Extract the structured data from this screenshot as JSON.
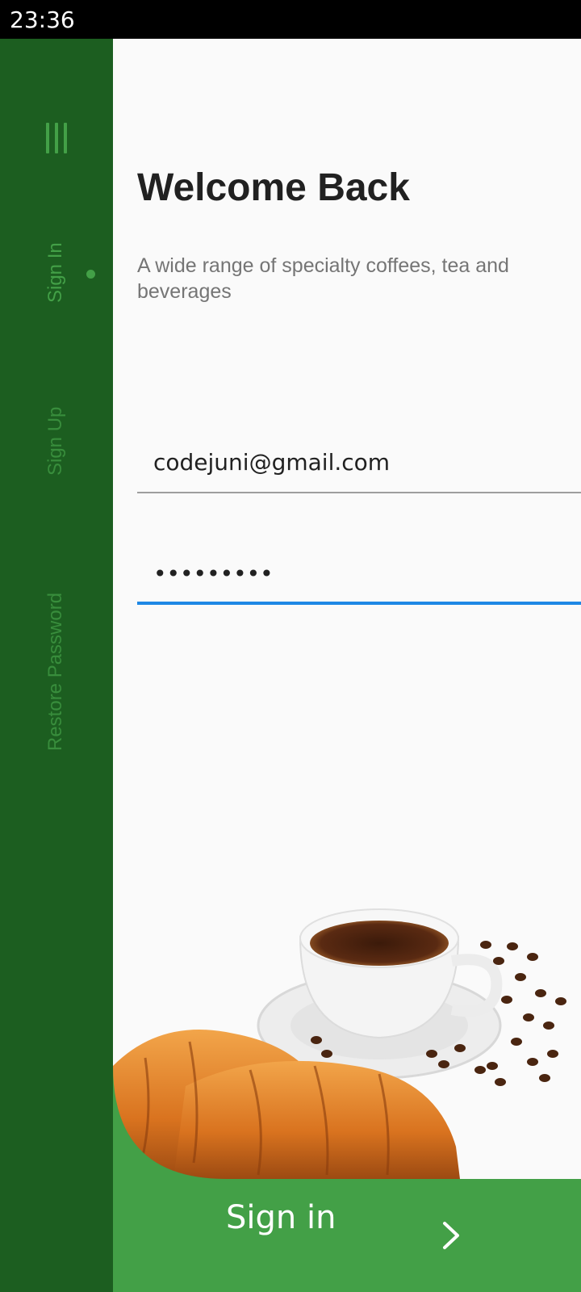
{
  "status_bar": {
    "time": "23:36"
  },
  "sidebar": {
    "menu_icon": "menu-icon",
    "items": [
      {
        "label": "Sign In",
        "active": true
      },
      {
        "label": "Sign Up",
        "active": false
      },
      {
        "label": "Restore Password",
        "active": false
      }
    ]
  },
  "main": {
    "title": "Welcome Back",
    "subtitle": "A wide range of specialty coffees, tea and beverages",
    "email_value": "codejuni@gmail.com",
    "password_value": "•••••••••",
    "illustration": "coffee-cup-croissants-image"
  },
  "footer": {
    "button_label": "Sign in",
    "icon": "chevron-right-icon"
  },
  "colors": {
    "sidebar": "#1c5e20",
    "accent": "#43a047",
    "focus": "#1e88e5"
  }
}
